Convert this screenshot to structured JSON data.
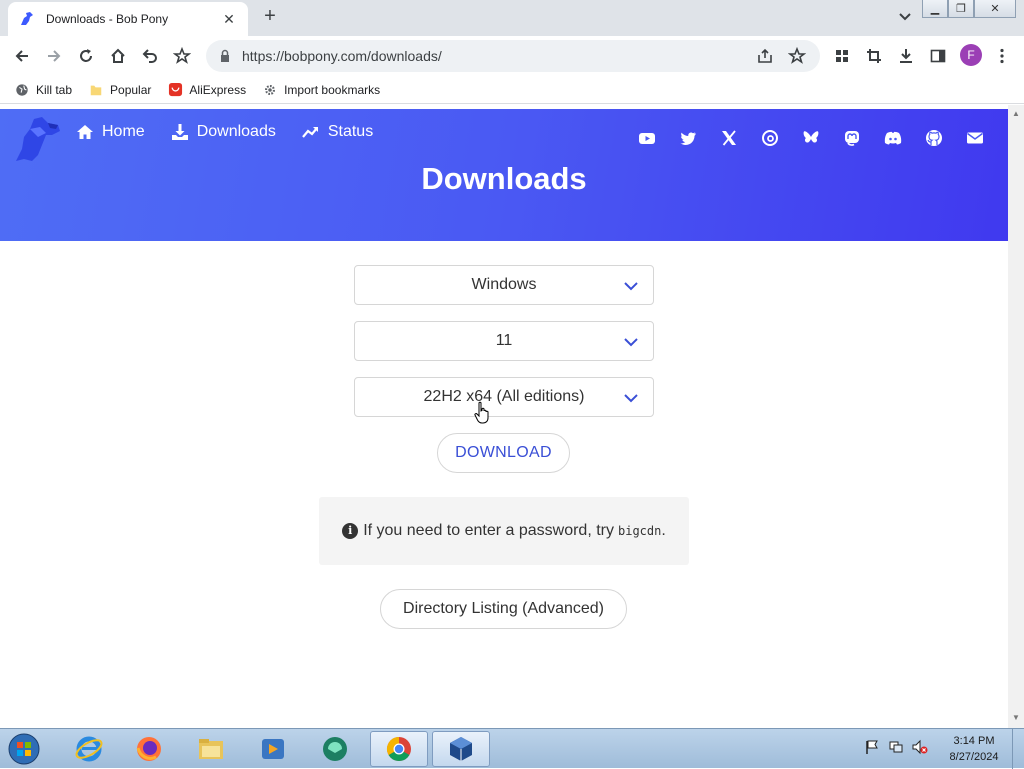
{
  "browser": {
    "tab_title": "Downloads - Bob Pony",
    "tab_close": "✕",
    "new_tab": "+",
    "url": "https://bobpony.com/downloads/",
    "profile_initial": "F"
  },
  "bookmarks": [
    {
      "label": "Kill tab",
      "icon": "globe-icon"
    },
    {
      "label": "Popular",
      "icon": "folder-icon"
    },
    {
      "label": "AliExpress",
      "icon": "aliexpress-icon"
    },
    {
      "label": "Import bookmarks",
      "icon": "gear-icon"
    }
  ],
  "nav": {
    "home": "Home",
    "downloads": "Downloads",
    "status": "Status"
  },
  "page": {
    "heading": "Downloads",
    "os_select": "Windows",
    "version_select": "11",
    "build_select": "22H2 x64 (All editions)",
    "download_button": "DOWNLOAD",
    "notice_text": "If you need to enter a password, try",
    "notice_code": "bigcdn",
    "notice_end": ".",
    "directory_button": "Directory Listing (Advanced)"
  },
  "taskbar": {
    "time": "3:14 PM",
    "date": "8/27/2024"
  },
  "colors": {
    "accent": "#4a59f3",
    "link": "#3a4fd6"
  }
}
